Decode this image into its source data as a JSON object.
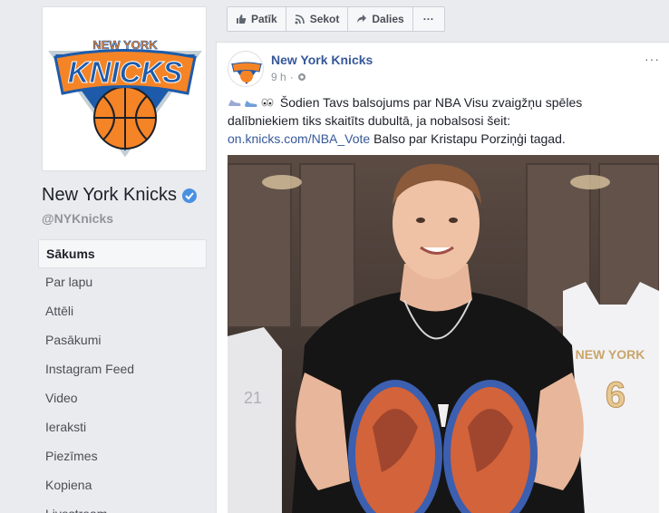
{
  "page": {
    "name": "New York Knicks",
    "handle": "@NYKnicks",
    "logo_text_top": "NEW YORK",
    "logo_text_main": "KNICKS"
  },
  "nav": {
    "items": [
      {
        "label": "Sākums",
        "active": true
      },
      {
        "label": "Par lapu"
      },
      {
        "label": "Attēli"
      },
      {
        "label": "Pasākumi"
      },
      {
        "label": "Instagram Feed"
      },
      {
        "label": "Video"
      },
      {
        "label": "Ieraksti"
      },
      {
        "label": "Piezīmes"
      },
      {
        "label": "Kopiena"
      },
      {
        "label": "Livestream"
      }
    ]
  },
  "actions": {
    "like": "Patīk",
    "follow": "Sekot",
    "share": "Dalies",
    "more": "···"
  },
  "post": {
    "author": "New York Knicks",
    "time": "9 h",
    "menu": "···",
    "text_main": "Šodien Tavs balsojums par NBA Visu zvaigžņu spēles dalībniekiem tiks skaitīts dubultā, ja nobalsosi šeit:",
    "link": "on.knicks.com/NBA_Vote",
    "text_after": " Balso par Kristapu Porziņģi tagad.",
    "photo_jersey_left_text": "NEW YORK",
    "photo_jersey_number": "6",
    "photo_jersey_left_number": "21"
  },
  "colors": {
    "knicks_blue": "#1d5baa",
    "knicks_orange": "#f58426",
    "link": "#365899",
    "background": "#e9ebee"
  }
}
